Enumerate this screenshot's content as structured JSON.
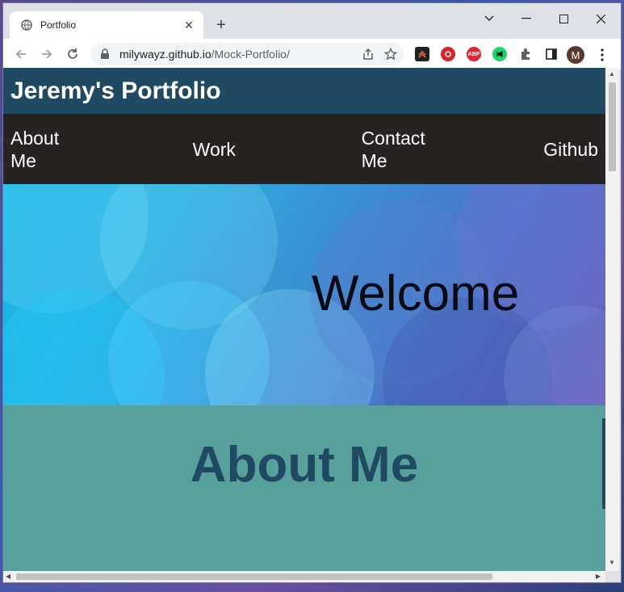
{
  "browser": {
    "tab_title": "Portfolio",
    "url_host": "milywayz.github.io",
    "url_path": "/Mock-Portfolio/",
    "profile_initial": "M",
    "extensions": [
      "abp-icon"
    ]
  },
  "site": {
    "title": "Jeremy's Portfolio",
    "nav": [
      {
        "label": "About\nMe"
      },
      {
        "label": "Work"
      },
      {
        "label": "Contact\nMe"
      },
      {
        "label": "Github"
      }
    ],
    "hero_text": "Welcome",
    "about_heading": "About Me"
  },
  "colors": {
    "header_bg": "#1f4a62",
    "nav_bg": "#282323",
    "about_bg": "#58a09b"
  }
}
